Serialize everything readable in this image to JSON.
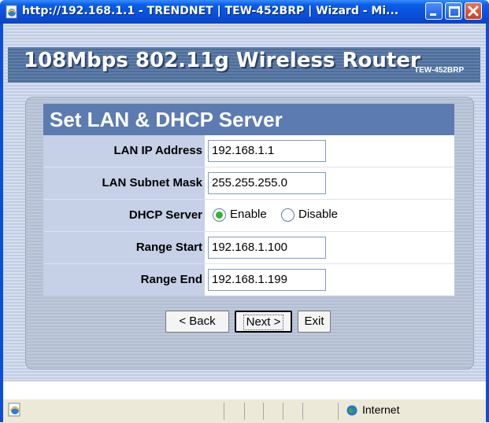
{
  "window": {
    "title": "http://192.168.1.1 - TRENDNET | TEW-452BRP | Wizard - Mi..."
  },
  "header": {
    "product_title": "108Mbps 802.11g Wireless Router",
    "model": "TEW-452BRP"
  },
  "form": {
    "title": "Set LAN & DHCP Server",
    "fields": {
      "lan_ip": {
        "label": "LAN IP Address",
        "value": "192.168.1.1"
      },
      "subnet": {
        "label": "LAN Subnet Mask",
        "value": "255.255.255.0"
      },
      "dhcp": {
        "label": "DHCP Server",
        "options": [
          "Enable",
          "Disable"
        ],
        "selected": "Enable"
      },
      "range_start": {
        "label": "Range Start",
        "value": "192.168.1.100"
      },
      "range_end": {
        "label": "Range End",
        "value": "192.168.1.199"
      }
    },
    "buttons": {
      "back": "< Back",
      "next": "Next >",
      "exit": "Exit"
    }
  },
  "statusbar": {
    "zone": "Internet"
  },
  "colors": {
    "accent": "#5c7bb0",
    "titlebar": "#0b4fd9"
  },
  "icons": [
    "ie-page-icon",
    "minimize-icon",
    "maximize-icon",
    "close-icon",
    "ie-status-icon",
    "internet-zone-icon"
  ]
}
